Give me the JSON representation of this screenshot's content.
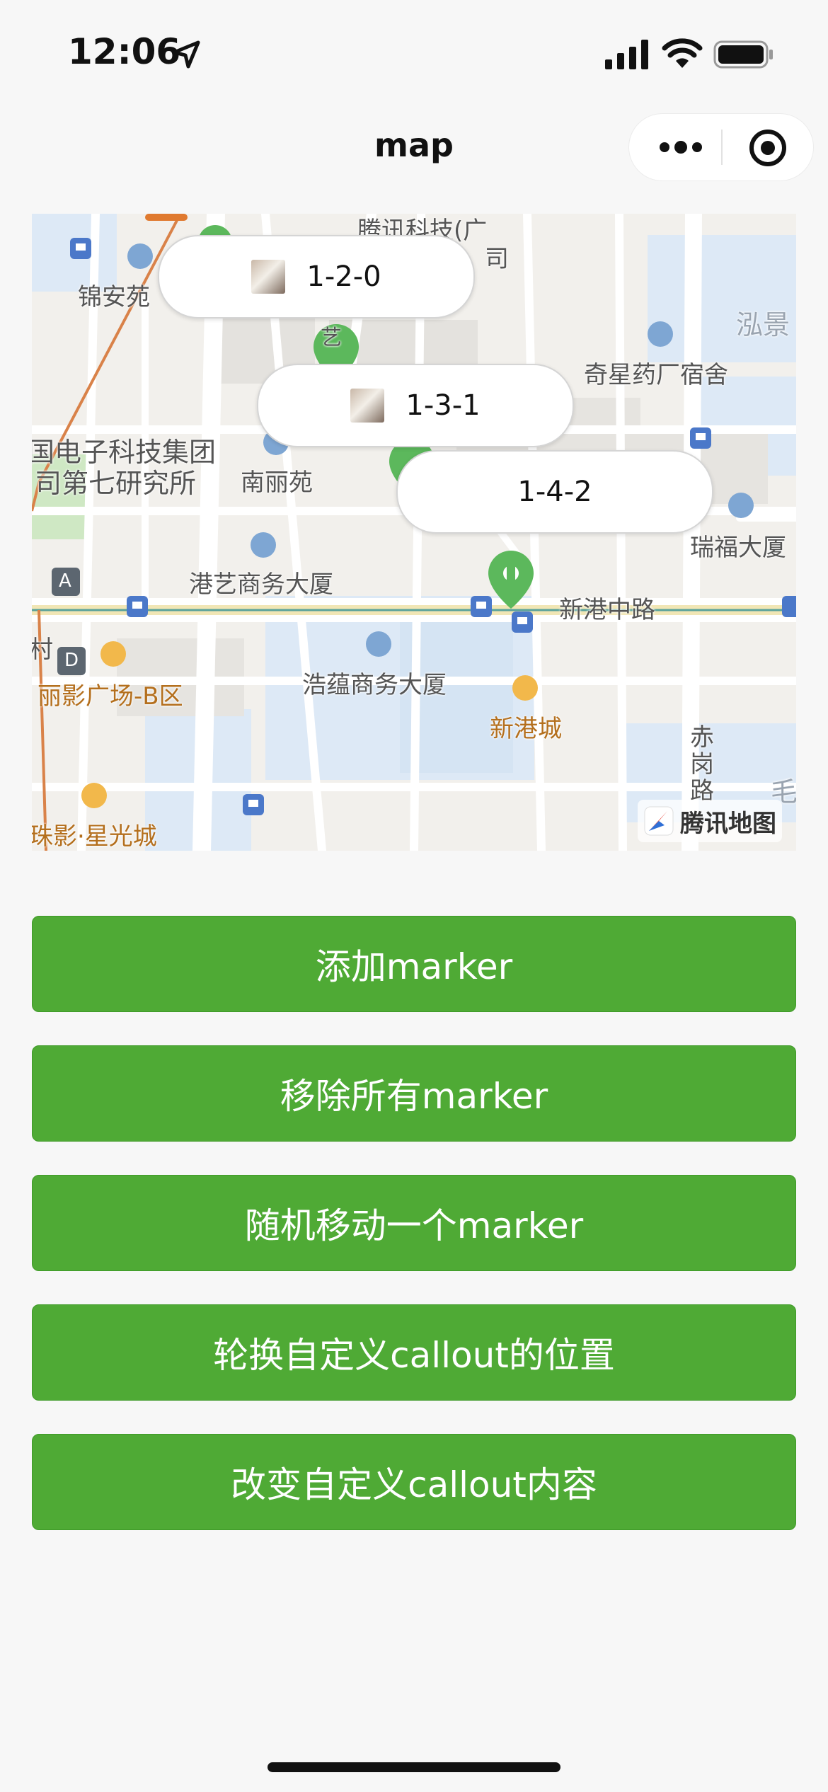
{
  "status_bar": {
    "time": "12:06"
  },
  "nav": {
    "title": "map"
  },
  "map": {
    "labels": {
      "jinanyuan": "锦安苑",
      "tencent_top": "腾讯科技(广",
      "tencent_top2": "司",
      "hongjing": "泓景",
      "qixing": "奇星药厂宿舍",
      "dianzi1": "国电子科技集团",
      "dianzi2": "司第七研究所",
      "nanliyuan": "南丽苑",
      "ruifu": "瑞福大厦",
      "gangyi": "港艺商务大厦",
      "xingangzhonglu": "新港中路",
      "cun": "村",
      "liying": "丽影广场-B区",
      "haoyun": "浩蕴商务大厦",
      "xingangcheng": "新港城",
      "chigang1": "赤",
      "chigang2": "岗",
      "chigang3": "路",
      "zhuying": "珠影·星光城",
      "mao": "毛",
      "yi": "艺",
      "metro_a": "A",
      "metro_d": "D"
    },
    "callouts": [
      {
        "text": "1-2-0"
      },
      {
        "text": "1-3-1"
      },
      {
        "text": "1-4-2"
      }
    ],
    "logo_text": "腾讯地图"
  },
  "buttons": {
    "add_marker": "添加marker",
    "remove_all": "移除所有marker",
    "move_random": "随机移动一个marker",
    "rotate_callout": "轮换自定义callout的位置",
    "change_callout": "改变自定义callout内容"
  },
  "colors": {
    "button_green": "#4faa35",
    "marker_green": "#5cb85c",
    "background": "#f7f7f7"
  }
}
